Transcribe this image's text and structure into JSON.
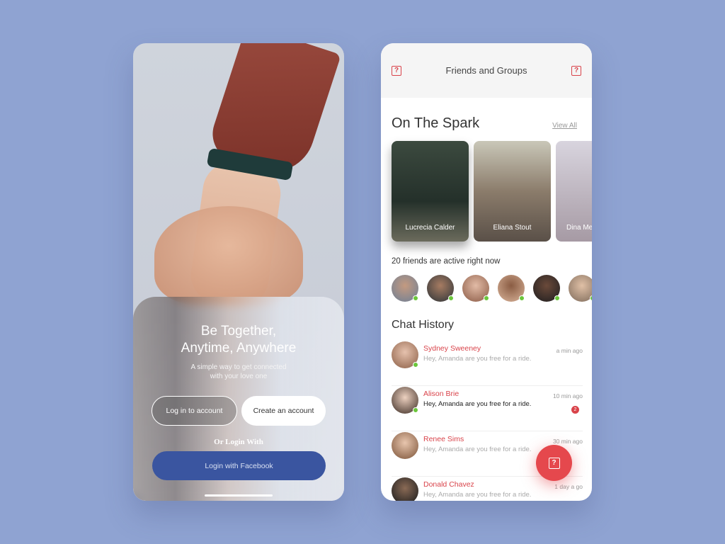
{
  "login": {
    "title_line1": "Be Together,",
    "title_line2": "Anytime, Anywhere",
    "subtitle_line1": "A simple way to get connected",
    "subtitle_line2": "with your love one",
    "login_button": "Log in to account",
    "create_button": "Create an account",
    "or_label": "Or Login With",
    "facebook_button": "Login with Facebook"
  },
  "friends": {
    "header_title": "Friends and Groups",
    "left_icon": "help-icon",
    "right_icon": "help-icon",
    "spark_title": "On The Spark",
    "view_all": "View All",
    "spark_cards": [
      {
        "name": "Lucrecia Calder"
      },
      {
        "name": "Eliana Stout"
      },
      {
        "name": "Dina Me"
      }
    ],
    "active_label": "20 friends are active right now",
    "chat_title": "Chat History",
    "chats": [
      {
        "name": "Sydney Sweeney",
        "message": "Hey, Amanda are you free for a ride.",
        "time": "a min ago",
        "online": true
      },
      {
        "name": "Alison Brie",
        "message": "Hey, Amanda are you free for a ride.",
        "time": "10 min ago",
        "online": true,
        "unread": "2"
      },
      {
        "name": "Renee Sims",
        "message": "Hey, Amanda are you free for a ride.",
        "time": "30 min ago",
        "online": false
      },
      {
        "name": "Donald Chavez",
        "message": "Hey, Amanda are you free for a ride.",
        "time": "1 day a go",
        "online": false
      }
    ],
    "fab_icon": "help-icon"
  },
  "colors": {
    "background": "#8fa3d2",
    "accent": "#d9434a",
    "facebook": "#3a55a0",
    "online": "#6bc63b"
  }
}
